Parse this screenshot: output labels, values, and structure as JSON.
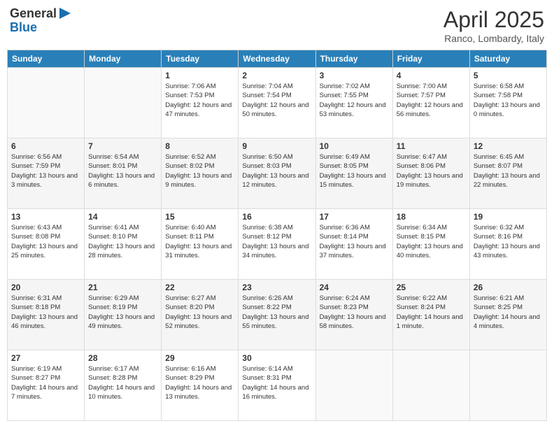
{
  "header": {
    "logo_line1": "General",
    "logo_line2": "Blue",
    "month": "April 2025",
    "location": "Ranco, Lombardy, Italy"
  },
  "weekdays": [
    "Sunday",
    "Monday",
    "Tuesday",
    "Wednesday",
    "Thursday",
    "Friday",
    "Saturday"
  ],
  "weeks": [
    [
      {
        "day": "",
        "info": ""
      },
      {
        "day": "",
        "info": ""
      },
      {
        "day": "1",
        "info": "Sunrise: 7:06 AM\nSunset: 7:53 PM\nDaylight: 12 hours and 47 minutes."
      },
      {
        "day": "2",
        "info": "Sunrise: 7:04 AM\nSunset: 7:54 PM\nDaylight: 12 hours and 50 minutes."
      },
      {
        "day": "3",
        "info": "Sunrise: 7:02 AM\nSunset: 7:55 PM\nDaylight: 12 hours and 53 minutes."
      },
      {
        "day": "4",
        "info": "Sunrise: 7:00 AM\nSunset: 7:57 PM\nDaylight: 12 hours and 56 minutes."
      },
      {
        "day": "5",
        "info": "Sunrise: 6:58 AM\nSunset: 7:58 PM\nDaylight: 13 hours and 0 minutes."
      }
    ],
    [
      {
        "day": "6",
        "info": "Sunrise: 6:56 AM\nSunset: 7:59 PM\nDaylight: 13 hours and 3 minutes."
      },
      {
        "day": "7",
        "info": "Sunrise: 6:54 AM\nSunset: 8:01 PM\nDaylight: 13 hours and 6 minutes."
      },
      {
        "day": "8",
        "info": "Sunrise: 6:52 AM\nSunset: 8:02 PM\nDaylight: 13 hours and 9 minutes."
      },
      {
        "day": "9",
        "info": "Sunrise: 6:50 AM\nSunset: 8:03 PM\nDaylight: 13 hours and 12 minutes."
      },
      {
        "day": "10",
        "info": "Sunrise: 6:49 AM\nSunset: 8:05 PM\nDaylight: 13 hours and 15 minutes."
      },
      {
        "day": "11",
        "info": "Sunrise: 6:47 AM\nSunset: 8:06 PM\nDaylight: 13 hours and 19 minutes."
      },
      {
        "day": "12",
        "info": "Sunrise: 6:45 AM\nSunset: 8:07 PM\nDaylight: 13 hours and 22 minutes."
      }
    ],
    [
      {
        "day": "13",
        "info": "Sunrise: 6:43 AM\nSunset: 8:08 PM\nDaylight: 13 hours and 25 minutes."
      },
      {
        "day": "14",
        "info": "Sunrise: 6:41 AM\nSunset: 8:10 PM\nDaylight: 13 hours and 28 minutes."
      },
      {
        "day": "15",
        "info": "Sunrise: 6:40 AM\nSunset: 8:11 PM\nDaylight: 13 hours and 31 minutes."
      },
      {
        "day": "16",
        "info": "Sunrise: 6:38 AM\nSunset: 8:12 PM\nDaylight: 13 hours and 34 minutes."
      },
      {
        "day": "17",
        "info": "Sunrise: 6:36 AM\nSunset: 8:14 PM\nDaylight: 13 hours and 37 minutes."
      },
      {
        "day": "18",
        "info": "Sunrise: 6:34 AM\nSunset: 8:15 PM\nDaylight: 13 hours and 40 minutes."
      },
      {
        "day": "19",
        "info": "Sunrise: 6:32 AM\nSunset: 8:16 PM\nDaylight: 13 hours and 43 minutes."
      }
    ],
    [
      {
        "day": "20",
        "info": "Sunrise: 6:31 AM\nSunset: 8:18 PM\nDaylight: 13 hours and 46 minutes."
      },
      {
        "day": "21",
        "info": "Sunrise: 6:29 AM\nSunset: 8:19 PM\nDaylight: 13 hours and 49 minutes."
      },
      {
        "day": "22",
        "info": "Sunrise: 6:27 AM\nSunset: 8:20 PM\nDaylight: 13 hours and 52 minutes."
      },
      {
        "day": "23",
        "info": "Sunrise: 6:26 AM\nSunset: 8:22 PM\nDaylight: 13 hours and 55 minutes."
      },
      {
        "day": "24",
        "info": "Sunrise: 6:24 AM\nSunset: 8:23 PM\nDaylight: 13 hours and 58 minutes."
      },
      {
        "day": "25",
        "info": "Sunrise: 6:22 AM\nSunset: 8:24 PM\nDaylight: 14 hours and 1 minute."
      },
      {
        "day": "26",
        "info": "Sunrise: 6:21 AM\nSunset: 8:25 PM\nDaylight: 14 hours and 4 minutes."
      }
    ],
    [
      {
        "day": "27",
        "info": "Sunrise: 6:19 AM\nSunset: 8:27 PM\nDaylight: 14 hours and 7 minutes."
      },
      {
        "day": "28",
        "info": "Sunrise: 6:17 AM\nSunset: 8:28 PM\nDaylight: 14 hours and 10 minutes."
      },
      {
        "day": "29",
        "info": "Sunrise: 6:16 AM\nSunset: 8:29 PM\nDaylight: 14 hours and 13 minutes."
      },
      {
        "day": "30",
        "info": "Sunrise: 6:14 AM\nSunset: 8:31 PM\nDaylight: 14 hours and 16 minutes."
      },
      {
        "day": "",
        "info": ""
      },
      {
        "day": "",
        "info": ""
      },
      {
        "day": "",
        "info": ""
      }
    ]
  ]
}
